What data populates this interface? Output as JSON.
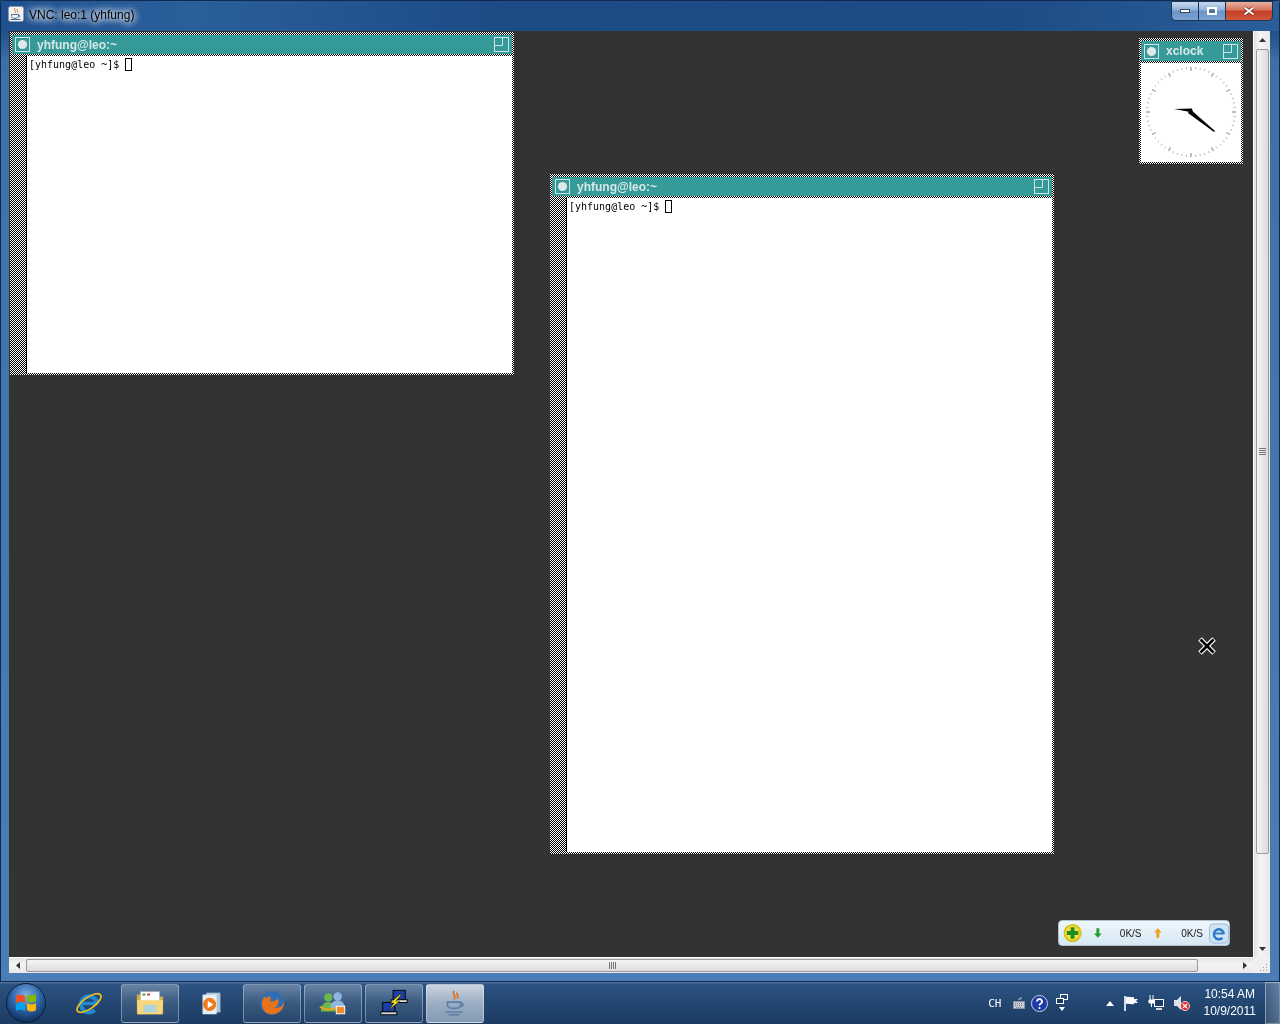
{
  "window": {
    "title": "VNC: leo:1 (yhfung)"
  },
  "desktop": {
    "windows": [
      {
        "kind": "terminal",
        "title": "yhfung@leo:~",
        "prompt": "[yhfung@leo ~]$"
      },
      {
        "kind": "terminal",
        "title": "yhfung@leo:~",
        "prompt": "[yhfung@leo ~]$"
      },
      {
        "kind": "clock",
        "title": "xclock"
      }
    ]
  },
  "speed_widget": {
    "download": "0K/S",
    "upload": "0K/S"
  },
  "taskbar": {
    "apps": [
      {
        "kind": "ebrowser",
        "running": false,
        "selected": false
      },
      {
        "kind": "folder",
        "running": true,
        "selected": false
      },
      {
        "kind": "player",
        "running": false,
        "selected": false
      },
      {
        "kind": "foxbrowser",
        "running": true,
        "selected": false
      },
      {
        "kind": "people",
        "running": true,
        "selected": false
      },
      {
        "kind": "remote",
        "running": true,
        "selected": false
      },
      {
        "kind": "cup",
        "running": true,
        "selected": true
      }
    ],
    "tray": {
      "language": "CH",
      "time": "10:54 AM",
      "date": "10/9/2011"
    }
  }
}
